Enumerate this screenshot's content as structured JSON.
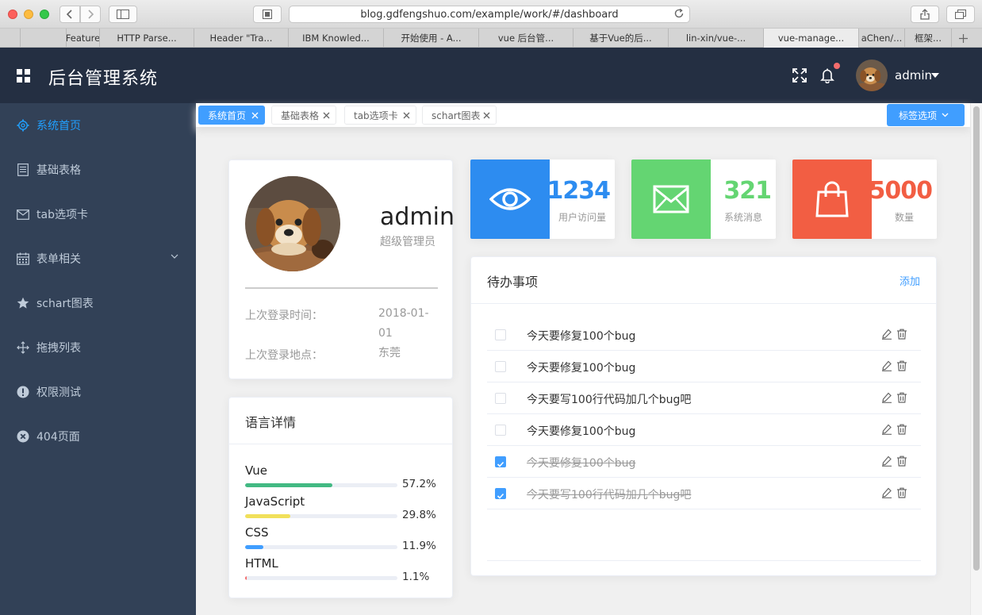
{
  "browser": {
    "url": "blog.gdfengshuo.com/example/work/#/dashboard",
    "tabs": [
      {
        "label": "",
        "w": 26
      },
      {
        "label": "",
        "w": 58
      },
      {
        "label": "Feature",
        "w": 42
      },
      {
        "label": "HTTP Parse...",
        "w": 119
      },
      {
        "label": "Header \"Tra...",
        "w": 119
      },
      {
        "label": "IBM Knowled...",
        "w": 120
      },
      {
        "label": "开始使用 - A...",
        "w": 120
      },
      {
        "label": "vue 后台管...",
        "w": 119
      },
      {
        "label": "基于Vue的后...",
        "w": 120
      },
      {
        "label": "lin-xin/vue-...",
        "w": 120
      },
      {
        "label": "vue-manage...",
        "w": 120,
        "active": true
      },
      {
        "label": "aChen/...",
        "w": 58
      },
      {
        "label": "框架...",
        "w": 59
      }
    ]
  },
  "header": {
    "title": "后台管理系统",
    "username": "admin"
  },
  "sidebar": {
    "items": [
      {
        "label": "系统首页",
        "icon": "gear-icon",
        "active": true
      },
      {
        "label": "基础表格",
        "icon": "document-icon"
      },
      {
        "label": "tab选项卡",
        "icon": "mail-icon"
      },
      {
        "label": "表单相关",
        "icon": "calendar-icon",
        "submenu": true
      },
      {
        "label": "schart图表",
        "icon": "star-icon"
      },
      {
        "label": "拖拽列表",
        "icon": "move-icon"
      },
      {
        "label": "权限测试",
        "icon": "warning-icon"
      },
      {
        "label": "404页面",
        "icon": "close-circle-icon"
      }
    ]
  },
  "tags": {
    "items": [
      {
        "label": "系统首页",
        "active": true
      },
      {
        "label": "基础表格"
      },
      {
        "label": "tab选项卡"
      },
      {
        "label": "schart图表"
      }
    ],
    "options_label": "标签选项"
  },
  "user_card": {
    "name": "admin",
    "role": "超级管理员",
    "last_login_time_label": "上次登录时间：",
    "last_login_time": "2018-01-01",
    "last_login_place_label": "上次登录地点：",
    "last_login_place": "东莞"
  },
  "language": {
    "title": "语言详情",
    "items": [
      {
        "name": "Vue",
        "percent": 57.2,
        "label": "57.2%",
        "color": "#42b983"
      },
      {
        "name": "JavaScript",
        "percent": 29.8,
        "label": "29.8%",
        "color": "#f1e05a"
      },
      {
        "name": "CSS",
        "percent": 11.9,
        "label": "11.9%",
        "color": "#409eff"
      },
      {
        "name": "HTML",
        "percent": 1.1,
        "label": "1.1%",
        "color": "#f56c6c"
      }
    ]
  },
  "stats": [
    {
      "value": "1234",
      "label": "用户访问量",
      "color": "#2d8cf0",
      "icon": "eye-icon"
    },
    {
      "value": "321",
      "label": "系统消息",
      "color": "#64d572",
      "icon": "envelope-icon"
    },
    {
      "value": "5000",
      "label": "数量",
      "color": "#f25e43",
      "icon": "shopping-bag-icon"
    }
  ],
  "todo": {
    "title": "待办事项",
    "add_label": "添加",
    "items": [
      {
        "text": "今天要修复100个bug",
        "done": false
      },
      {
        "text": "今天要修复100个bug",
        "done": false
      },
      {
        "text": "今天要写100行代码加几个bug吧",
        "done": false
      },
      {
        "text": "今天要修复100个bug",
        "done": false
      },
      {
        "text": "今天要修复100个bug",
        "done": true
      },
      {
        "text": "今天要写100行代码加几个bug吧",
        "done": true
      }
    ]
  }
}
